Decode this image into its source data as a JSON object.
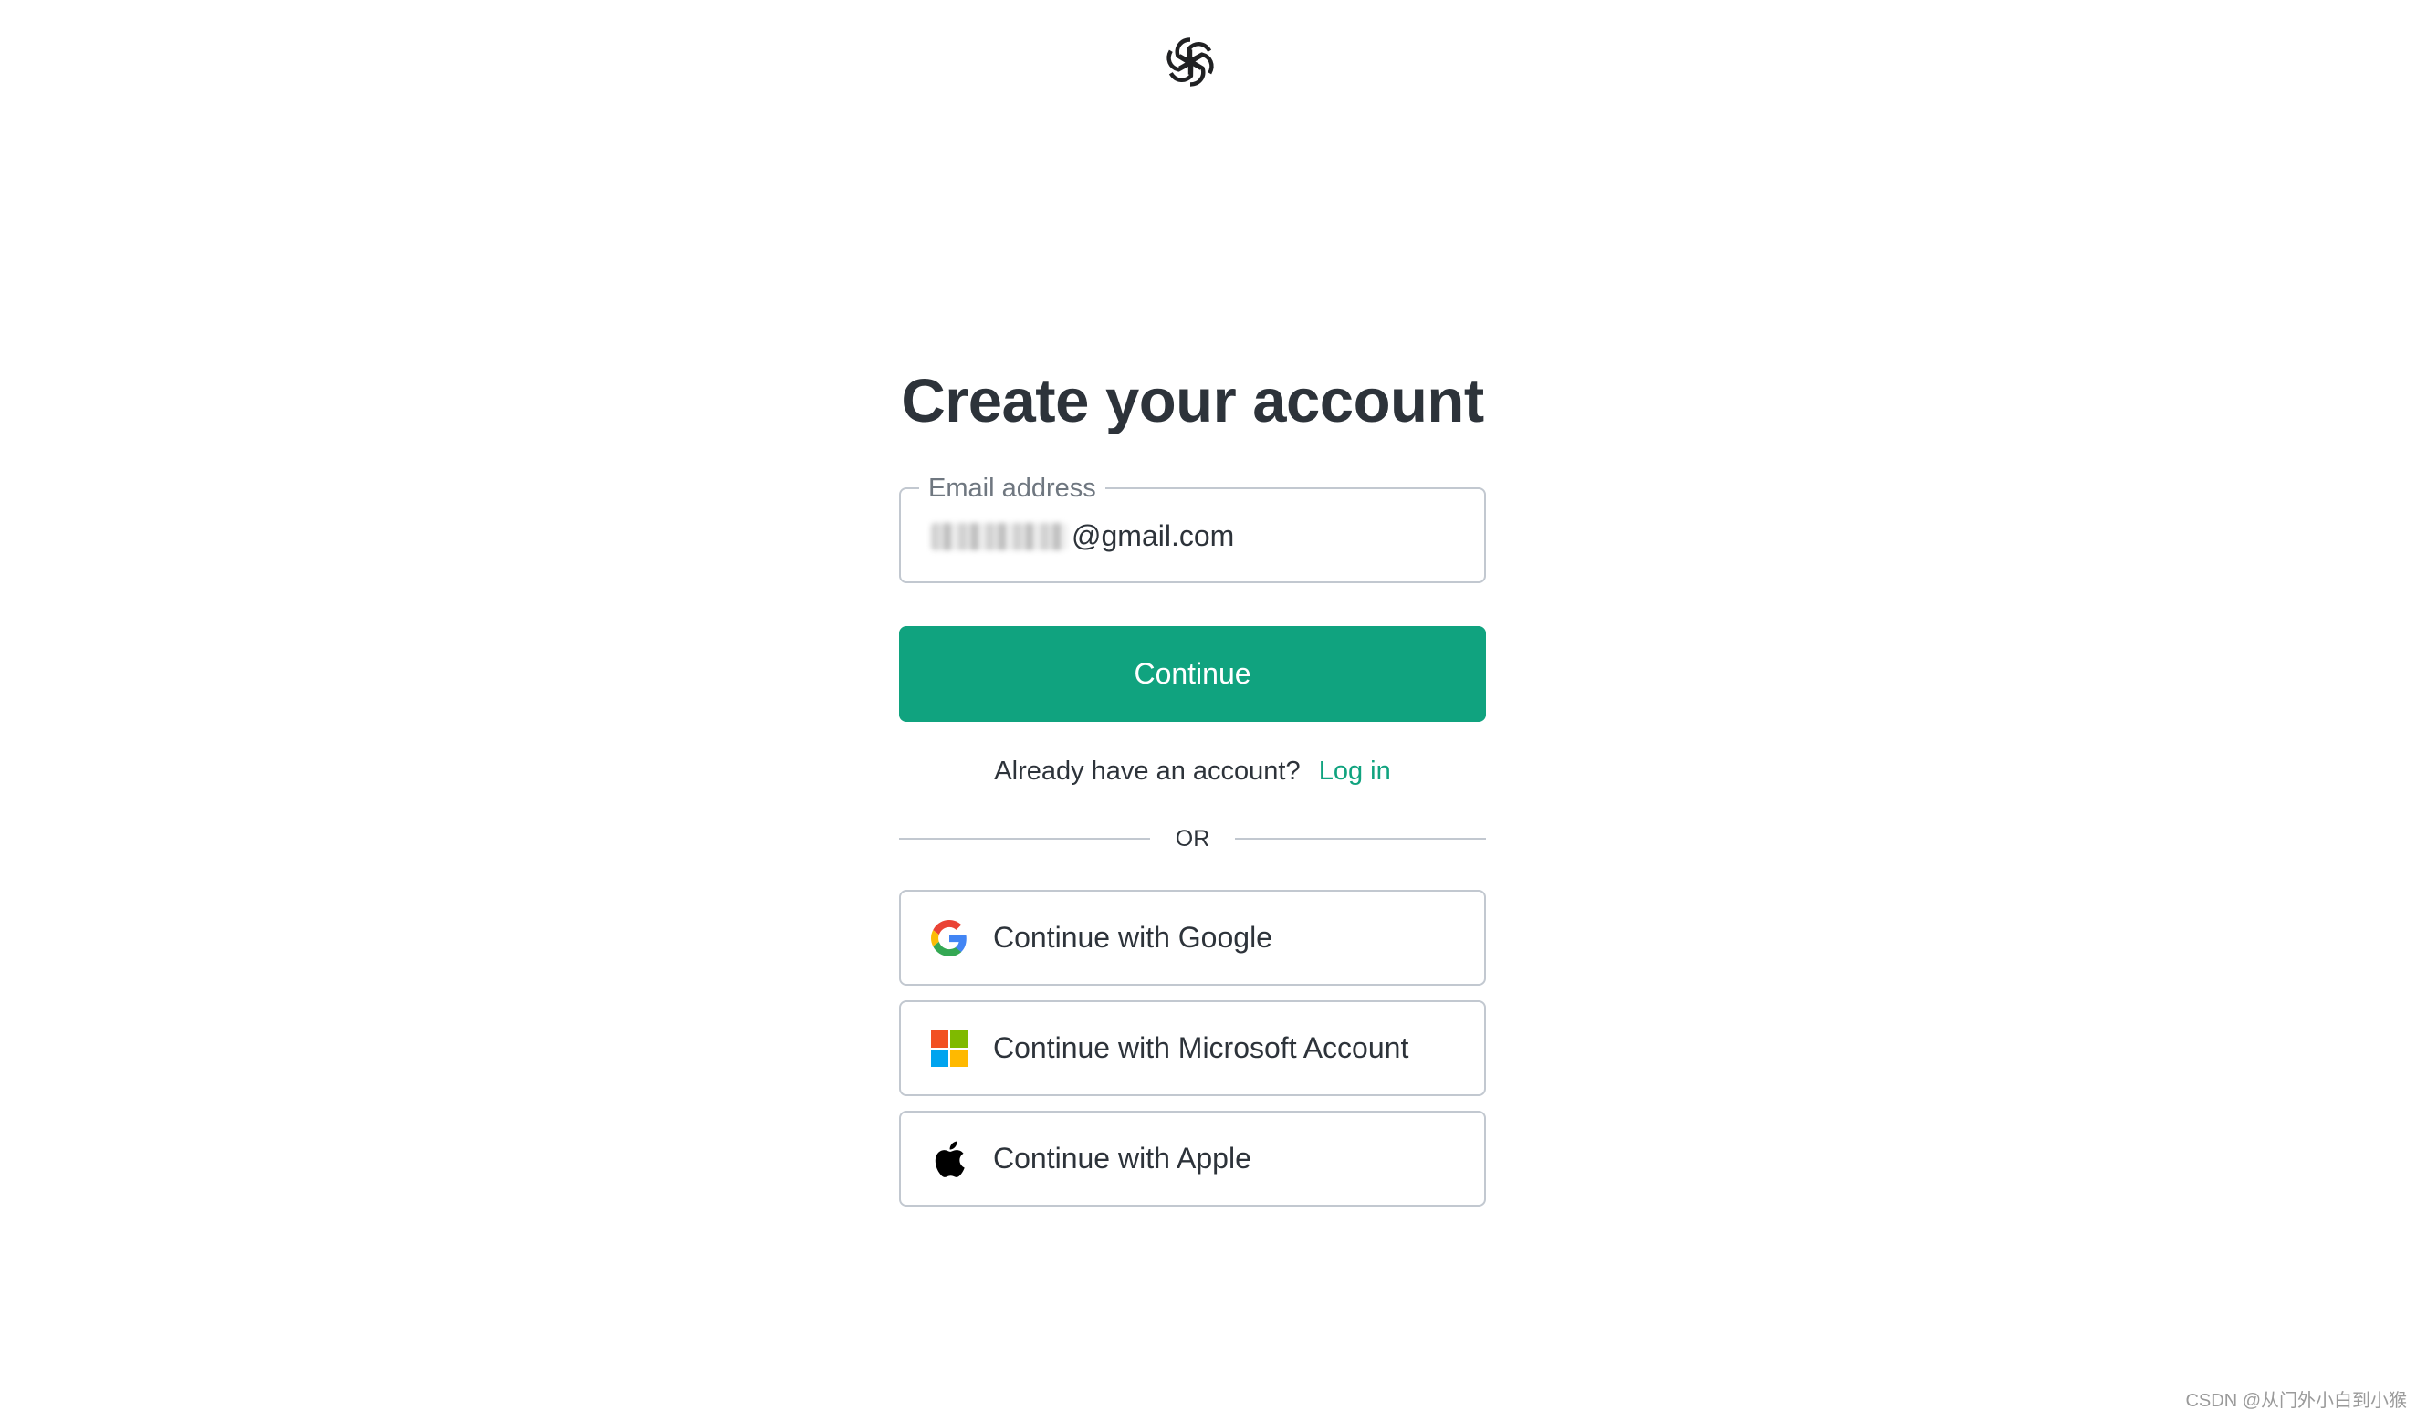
{
  "brand": {
    "logo_icon": "openai-logo-icon",
    "accent_color": "#10a37f"
  },
  "signup": {
    "title": "Create your account",
    "email_label": "Email address",
    "email_value_visible": "@gmail.com",
    "continue_label": "Continue",
    "login_prompt": "Already have an account?",
    "login_link": "Log in",
    "divider_text": "OR"
  },
  "social": [
    {
      "label": "Continue with Google",
      "icon": "google-icon"
    },
    {
      "label": "Continue with Microsoft Account",
      "icon": "microsoft-icon"
    },
    {
      "label": "Continue with Apple",
      "icon": "apple-icon"
    }
  ],
  "watermark": "CSDN @从门外小白到小猴"
}
